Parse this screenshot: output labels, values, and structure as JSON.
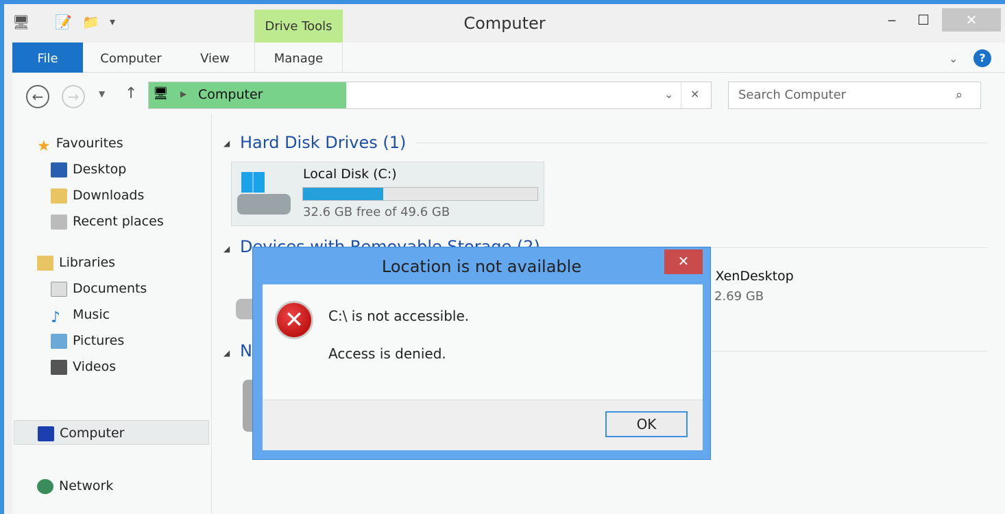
{
  "window": {
    "title": "Computer",
    "minimize": "‒",
    "maximize": "☐",
    "close": "✕"
  },
  "ribbon": {
    "contextual_group": "Drive Tools",
    "tabs": [
      {
        "label": "File"
      },
      {
        "label": "Computer"
      },
      {
        "label": "View"
      },
      {
        "label": "Manage"
      }
    ],
    "help": "?"
  },
  "address": {
    "path": "Computer",
    "search_placeholder": "Search Computer"
  },
  "sidebar": {
    "favourites": {
      "label": "Favourites",
      "items": [
        {
          "label": "Desktop"
        },
        {
          "label": "Downloads"
        },
        {
          "label": "Recent places"
        }
      ]
    },
    "libraries": {
      "label": "Libraries",
      "items": [
        {
          "label": "Documents"
        },
        {
          "label": "Music"
        },
        {
          "label": "Pictures"
        },
        {
          "label": "Videos"
        }
      ]
    },
    "computer": "Computer",
    "network": "Network"
  },
  "main": {
    "hdd_section": "Hard Disk Drives (1)",
    "local_disk": {
      "name": "Local Disk (C:)",
      "free_text": "32.6 GB free of 49.6 GB",
      "used_fraction": 0.343
    },
    "removable_section": "Devices with Removable Storage (2)",
    "removable_item_name_partial": ") XenDesktop",
    "removable_item_size_partial": "f 2.69 GB",
    "third_section_partial": "N"
  },
  "dialog": {
    "title": "Location is not available",
    "close": "✕",
    "message": "C:\\ is not accessible.",
    "detail": "Access is denied.",
    "ok": "OK"
  },
  "colors": {
    "accent": "#1a73c9",
    "address_highlight": "#79d28a",
    "drive_tools": "#bde98f",
    "dialog_frame": "#63a7ee",
    "close_red": "#c94b4b",
    "progress": "#26a0da"
  }
}
